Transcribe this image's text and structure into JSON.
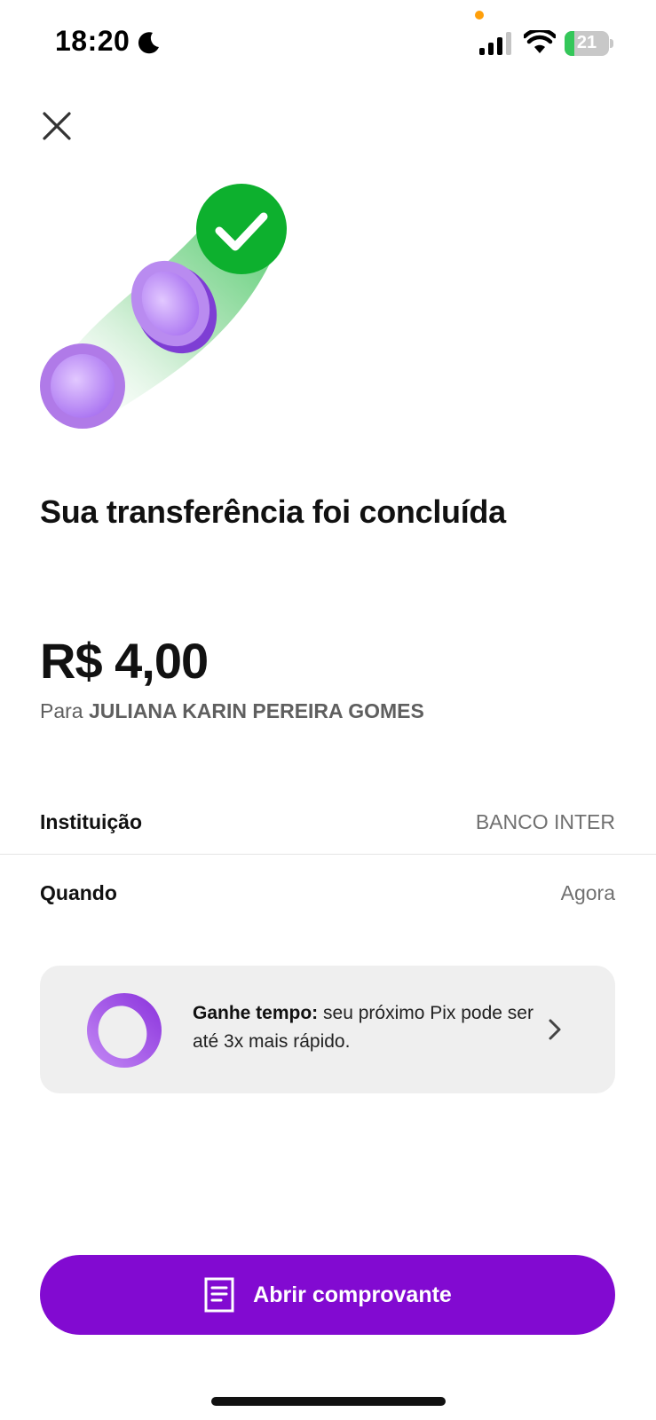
{
  "status_bar": {
    "time": "18:20",
    "battery": "21",
    "battery_level": 0.21,
    "icons": [
      "moon-icon",
      "signal-icon",
      "wifi-icon",
      "battery-icon"
    ]
  },
  "colors": {
    "accent_purple": "#820AD1",
    "success_green": "#0DB02E",
    "battery_green": "#34C759",
    "orange_dot": "#FF9F0A"
  },
  "header": {
    "close_icon": "close-icon"
  },
  "main": {
    "title": "Sua transferência foi concluída",
    "amount": "R$ 4,00",
    "recipient_prefix": "Para",
    "recipient_name": "JULIANA KARIN PEREIRA GOMES"
  },
  "details": [
    {
      "label": "Instituição",
      "value": "BANCO INTER"
    },
    {
      "label": "Quando",
      "value": "Agora"
    }
  ],
  "promo": {
    "bold": "Ganhe tempo:",
    "text": "seu próximo Pix pode ser até 3x mais rápido."
  },
  "actions": {
    "primary_label": "Abrir comprovante"
  }
}
